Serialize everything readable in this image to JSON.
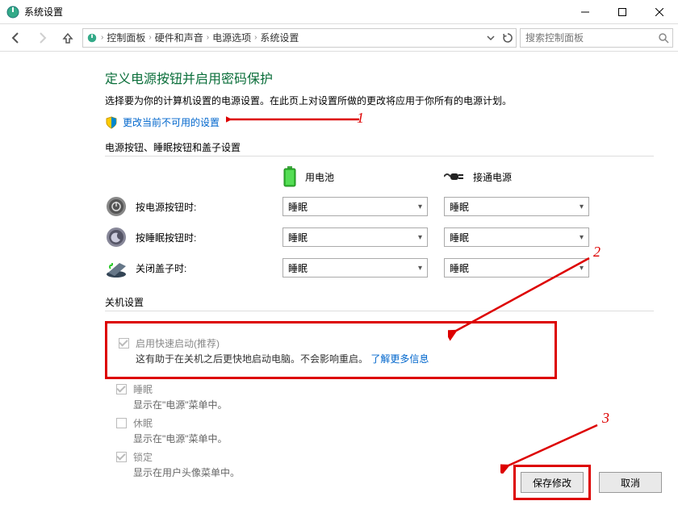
{
  "window": {
    "title": "系统设置"
  },
  "breadcrumb": {
    "items": [
      "控制面板",
      "硬件和声音",
      "电源选项",
      "系统设置"
    ]
  },
  "search": {
    "placeholder": "搜索控制面板"
  },
  "page": {
    "heading": "定义电源按钮并启用密码保护",
    "description": "选择要为你的计算机设置的电源设置。在此页上对设置所做的更改将应用于你所有的电源计划。",
    "change_link": "更改当前不可用的设置"
  },
  "section1": {
    "title": "电源按钮、睡眠按钮和盖子设置",
    "col_battery": "用电池",
    "col_ac": "接通电源",
    "rows": [
      {
        "label": "按电源按钮时:",
        "battery": "睡眠",
        "ac": "睡眠"
      },
      {
        "label": "按睡眠按钮时:",
        "battery": "睡眠",
        "ac": "睡眠"
      },
      {
        "label": "关闭盖子时:",
        "battery": "睡眠",
        "ac": "睡眠"
      }
    ]
  },
  "section2": {
    "title": "关机设置",
    "fast_startup": {
      "label": "启用快速启动(推荐)",
      "sub_prefix": "这有助于在关机之后更快地启动电脑。不会影响重启。",
      "sub_link": "了解更多信息"
    },
    "sleep": {
      "label": "睡眠",
      "sub": "显示在\"电源\"菜单中。"
    },
    "hibernate": {
      "label": "休眠",
      "sub": "显示在\"电源\"菜单中。"
    },
    "lock": {
      "label": "锁定",
      "sub": "显示在用户头像菜单中。"
    }
  },
  "footer": {
    "save": "保存修改",
    "cancel": "取消"
  },
  "annotations": {
    "n1": "1",
    "n2": "2",
    "n3": "3"
  }
}
